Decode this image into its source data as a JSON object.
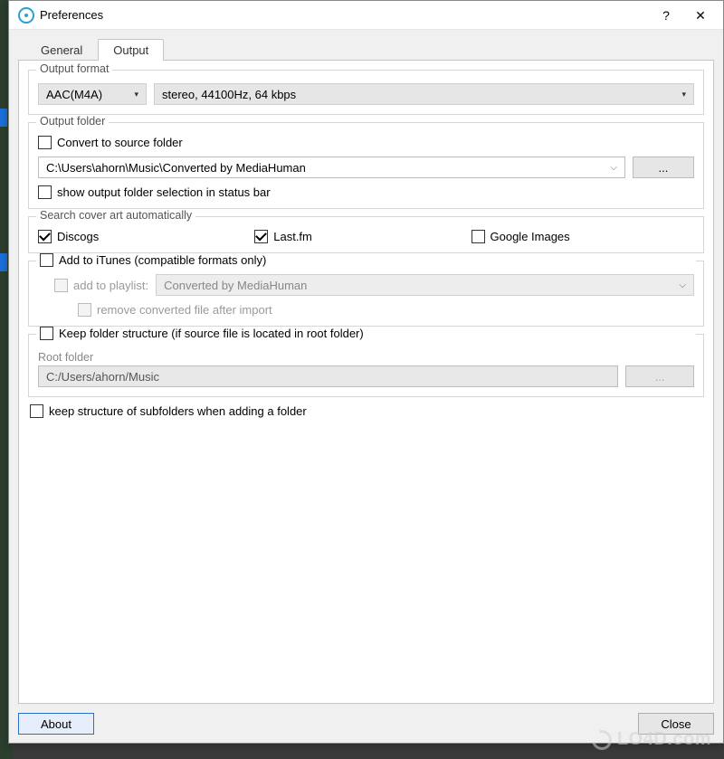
{
  "window": {
    "title": "Preferences",
    "help": "?",
    "close": "✕"
  },
  "tabs": {
    "general": "General",
    "output": "Output"
  },
  "output_format": {
    "legend": "Output format",
    "codec": "AAC(M4A)",
    "quality": "stereo, 44100Hz, 64 kbps"
  },
  "output_folder": {
    "legend": "Output folder",
    "convert_to_source": "Convert to source folder",
    "path": "C:\\Users\\ahorn\\Music\\Converted by MediaHuman",
    "browse": "...",
    "show_in_status": "show output folder selection in status bar"
  },
  "cover_art": {
    "legend": "Search cover art automatically",
    "discogs": "Discogs",
    "lastfm": "Last.fm",
    "google": "Google Images"
  },
  "itunes": {
    "header": "Add to iTunes (compatible formats only)",
    "add_to_playlist": "add to playlist:",
    "playlist": "Converted by MediaHuman",
    "remove_after": "remove converted file after import"
  },
  "keep_structure": {
    "header": "Keep folder structure (if source file is located in root folder)",
    "root_label": "Root folder",
    "root_path": "C:/Users/ahorn/Music",
    "browse": "..."
  },
  "subfolders": {
    "label": "keep structure of subfolders when adding a folder"
  },
  "buttons": {
    "about": "About",
    "close": "Close"
  },
  "watermark": "LO4D.com"
}
